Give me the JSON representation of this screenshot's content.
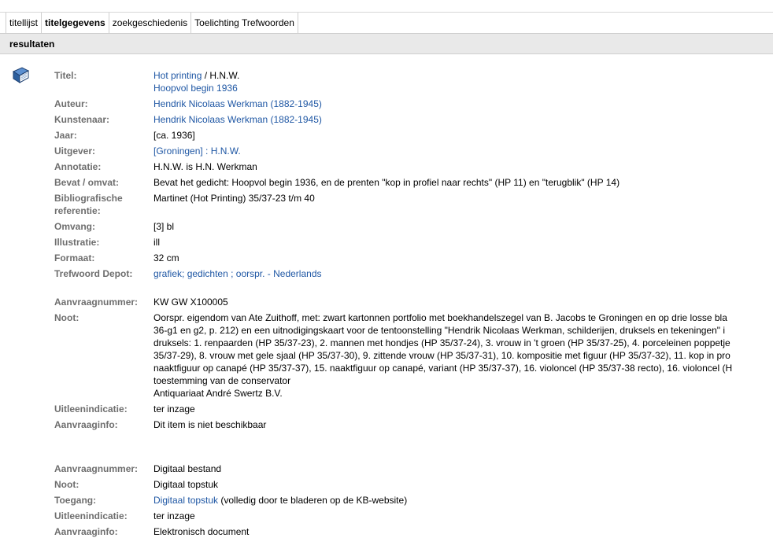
{
  "tabs": [
    "titellijst",
    "titelgegevens",
    "zoekgeschiedenis",
    "Toelichting Trefwoorden"
  ],
  "results_header": "resultaten",
  "book_icon": "book-icon",
  "record": {
    "titel": {
      "label": "Titel:",
      "link1": "Hot printing",
      "sep": " / H.N.W.",
      "link2": "Hoopvol begin 1936"
    },
    "auteur": {
      "label": "Auteur:",
      "value": "Hendrik Nicolaas Werkman (1882-1945)"
    },
    "kunstenaar": {
      "label": "Kunstenaar:",
      "value": "Hendrik Nicolaas Werkman (1882-1945)"
    },
    "jaar": {
      "label": "Jaar:",
      "value": "[ca. 1936]"
    },
    "uitgever": {
      "label": "Uitgever:",
      "open": "[",
      "place": "Groningen",
      "close": "] : ",
      "name": "H.N.W."
    },
    "annotatie": {
      "label": "Annotatie:",
      "value": "H.N.W. is H.N. Werkman"
    },
    "bevat": {
      "label": "Bevat / omvat:",
      "value": "Bevat het gedicht: Hoopvol begin 1936, en de prenten \"kop in profiel naar rechts\" (HP 11) en \"terugblik\" (HP 14)"
    },
    "biblio": {
      "label1": "Bibliografische",
      "label2": "referentie:",
      "value": "Martinet (Hot Printing) 35/37-23 t/m 40"
    },
    "omvang": {
      "label": "Omvang:",
      "value": "[3] bl"
    },
    "illustratie": {
      "label": "Illustratie:",
      "value": "ill"
    },
    "formaat": {
      "label": "Formaat:",
      "value": "32 cm"
    },
    "trefwoord": {
      "label": "Trefwoord Depot:",
      "link1": "grafiek",
      "sep1": "; ",
      "link2": "gedichten",
      "sep2": " ; ",
      "link3": "oorspr. - Nederlands"
    }
  },
  "holding1": {
    "aanvraagnummer": {
      "label": "Aanvraagnummer:",
      "value": "KW GW X100005"
    },
    "noot": {
      "label": "Noot:",
      "lines": [
        "Oorspr. eigendom van Ate Zuithoff, met: zwart kartonnen portfolio met boekhandelszegel van B. Jacobs te Groningen en op drie losse bla",
        "36-g1 en g2, p. 212) en een uitnodigingskaart voor de tentoonstelling \"Hendrik Nicolaas Werkman, schilderijen, druksels en tekeningen\" i",
        "druksels: 1. renpaarden (HP 35/37-23), 2. mannen met hondjes (HP 35/37-24), 3. vrouw in 't groen (HP 35/37-25), 4. porceleinen poppetje",
        "35/37-29), 8. vrouw met gele sjaal (HP 35/37-30), 9. zittende vrouw (HP 35/37-31), 10. kompositie met figuur (HP 35/37-32), 11. kop in pro",
        "naaktfiguur op canapé (HP 35/37-37), 15. naaktfiguur op canapé, variant (HP 35/37-37), 16. violoncel (HP 35/37-38 recto), 16. violoncel (H",
        "toestemming van de conservator",
        "Antiquariaat André Swertz B.V."
      ]
    },
    "uitleen": {
      "label": "Uitleenindicatie:",
      "value": "ter inzage"
    },
    "aanvraaginfo": {
      "label": "Aanvraaginfo:",
      "value": "Dit item is niet beschikbaar"
    }
  },
  "holding2": {
    "aanvraagnummer": {
      "label": "Aanvraagnummer:",
      "value": "Digitaal bestand"
    },
    "noot": {
      "label": "Noot:",
      "value": "Digitaal topstuk"
    },
    "toegang": {
      "label": "Toegang:",
      "link": "Digitaal topstuk",
      "text": " (volledig door te bladeren op de KB-website)"
    },
    "uitleen": {
      "label": "Uitleenindicatie:",
      "value": "ter inzage"
    },
    "aanvraaginfo": {
      "label": "Aanvraaginfo:",
      "value": "Elektronisch document"
    }
  },
  "colors": {
    "link": "#1f57a4",
    "label": "#6e6e6e",
    "header_bg": "#e9e9e9",
    "icon": "#2c5f9e"
  }
}
